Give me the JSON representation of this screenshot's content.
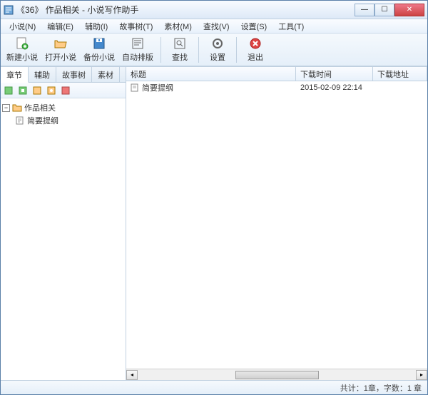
{
  "window": {
    "title": "《36》 作品相关 - 小说写作助手"
  },
  "menu": {
    "items": [
      "小说(N)",
      "编辑(E)",
      "辅助(I)",
      "故事树(T)",
      "素材(M)",
      "查找(V)",
      "设置(S)",
      "工具(T)"
    ]
  },
  "toolbar": {
    "new_label": "新建小说",
    "open_label": "打开小说",
    "backup_label": "备份小说",
    "autoformat_label": "自动排版",
    "find_label": "查找",
    "settings_label": "设置",
    "exit_label": "退出"
  },
  "tabs": {
    "items": [
      "章节",
      "辅助",
      "故事树",
      "素材"
    ],
    "active_index": 0
  },
  "tree": {
    "root_label": "作品相关",
    "child_label": "简要提纲"
  },
  "list": {
    "headers": {
      "title": "标题",
      "time": "下载时间",
      "addr": "下载地址"
    },
    "rows": [
      {
        "title": "简要提纲",
        "time": "2015-02-09 22:14",
        "addr": ""
      }
    ]
  },
  "status": {
    "text": "共计：1章，字数：1 章"
  }
}
